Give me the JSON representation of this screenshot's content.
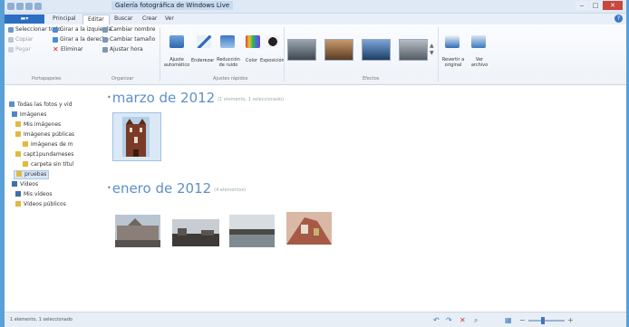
{
  "window": {
    "title": "Galería fotográfica de Windows Live"
  },
  "tabs": {
    "file": "",
    "items": [
      "Principal",
      "Editar",
      "Buscar",
      "Crear",
      "Ver"
    ]
  },
  "ribbon": {
    "manage": {
      "buttons": [
        "Seleccionar todo",
        "Girar a la izquierda",
        "Cambiar nombre",
        "Copiar",
        "Girar a la derecha",
        "Cambiar tamaño",
        "Pegar",
        "Eliminar",
        "Ajustar hora"
      ],
      "label_left": "Portapapeles",
      "label_mid": "Organizar"
    },
    "adjust": {
      "buttons": [
        "Ajuste automático",
        "Enderezar",
        "Reducción de ruido",
        "Color",
        "Exposición"
      ],
      "label": "Ajustes rápidos"
    },
    "effects": {
      "label": "Efectos"
    },
    "share": {
      "buttons": [
        "Revertir a original",
        "Ver archivo"
      ]
    }
  },
  "sidebar": {
    "items": [
      "Todas las fotos y vid",
      "Imágenes",
      "Mis imágenes",
      "Imágenes públicas",
      "Imágenes de m",
      "capt1pundameses",
      "carpeta sin títul",
      "pruebas",
      "Vídeos",
      "Mis vídeos",
      "Vídeos públicos"
    ]
  },
  "groups": [
    {
      "title": "marzo de 2012",
      "count": "(1 elemento, 1 seleccionado)"
    },
    {
      "title": "enero de 2012",
      "count": "(4 elementos)"
    }
  ],
  "status": {
    "text": "1 elemento, 1 seleccionado"
  },
  "colors": {
    "accent": "#2b6ec2",
    "heading": "#5f8fc8",
    "desktop": "#5a9fd6"
  }
}
